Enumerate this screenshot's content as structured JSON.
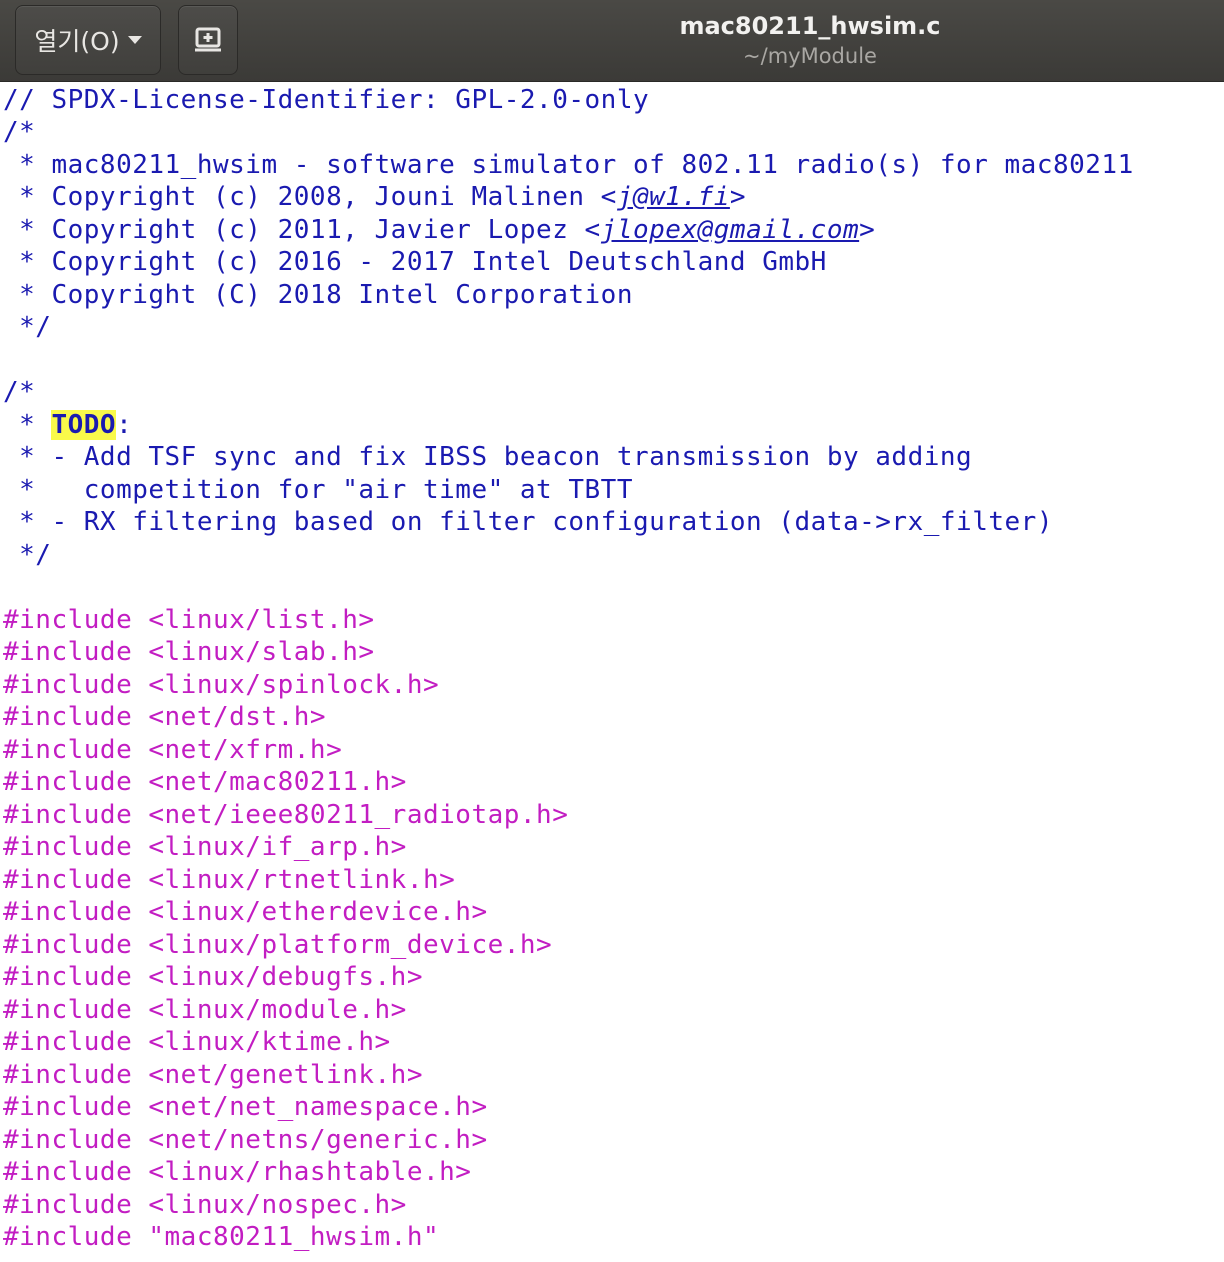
{
  "window": {
    "open_button_label": "열기(O)",
    "title": "mac80211_hwsim.c",
    "path": "~/myModule"
  },
  "editor": {
    "header_comment": {
      "line1": "// SPDX-License-Identifier: GPL-2.0-only",
      "line2": "/*",
      "line3": " * mac80211_hwsim - software simulator of 802.11 radio(s) for mac80211",
      "line4_pre": " * Copyright (c) 2008, Jouni Malinen <",
      "line4_email": "j@w1.fi",
      "line4_post": ">",
      "line5_pre": " * Copyright (c) 2011, Javier Lopez <",
      "line5_email": "jlopex@gmail.com",
      "line5_post": ">",
      "line6": " * Copyright (c) 2016 - 2017 Intel Deutschland GmbH",
      "line7": " * Copyright (C) 2018 Intel Corporation",
      "line8": " */"
    },
    "todo_comment": {
      "line1": "/*",
      "line2_pre": " * ",
      "line2_todo": "TODO",
      "line2_post": ":",
      "line3": " * - Add TSF sync and fix IBSS beacon transmission by adding",
      "line4": " *   competition for \"air time\" at TBTT",
      "line5": " * - RX filtering based on filter configuration (data->rx_filter)",
      "line6": " */"
    },
    "includes": [
      "#include <linux/list.h>",
      "#include <linux/slab.h>",
      "#include <linux/spinlock.h>",
      "#include <net/dst.h>",
      "#include <net/xfrm.h>",
      "#include <net/mac80211.h>",
      "#include <net/ieee80211_radiotap.h>",
      "#include <linux/if_arp.h>",
      "#include <linux/rtnetlink.h>",
      "#include <linux/etherdevice.h>",
      "#include <linux/platform_device.h>",
      "#include <linux/debugfs.h>",
      "#include <linux/module.h>",
      "#include <linux/ktime.h>",
      "#include <net/genetlink.h>",
      "#include <net/net_namespace.h>",
      "#include <net/netns/generic.h>",
      "#include <linux/rhashtable.h>",
      "#include <linux/nospec.h>",
      "#include \"mac80211_hwsim.h\""
    ]
  },
  "colors": {
    "comment": "#1a1ab0",
    "preprocessor": "#c21dc2",
    "todo_highlight": "#f9f94a",
    "titlebar": "#3f3e3b"
  },
  "icons": {
    "new_document": "new-document-icon",
    "dropdown": "chevron-down-icon"
  }
}
